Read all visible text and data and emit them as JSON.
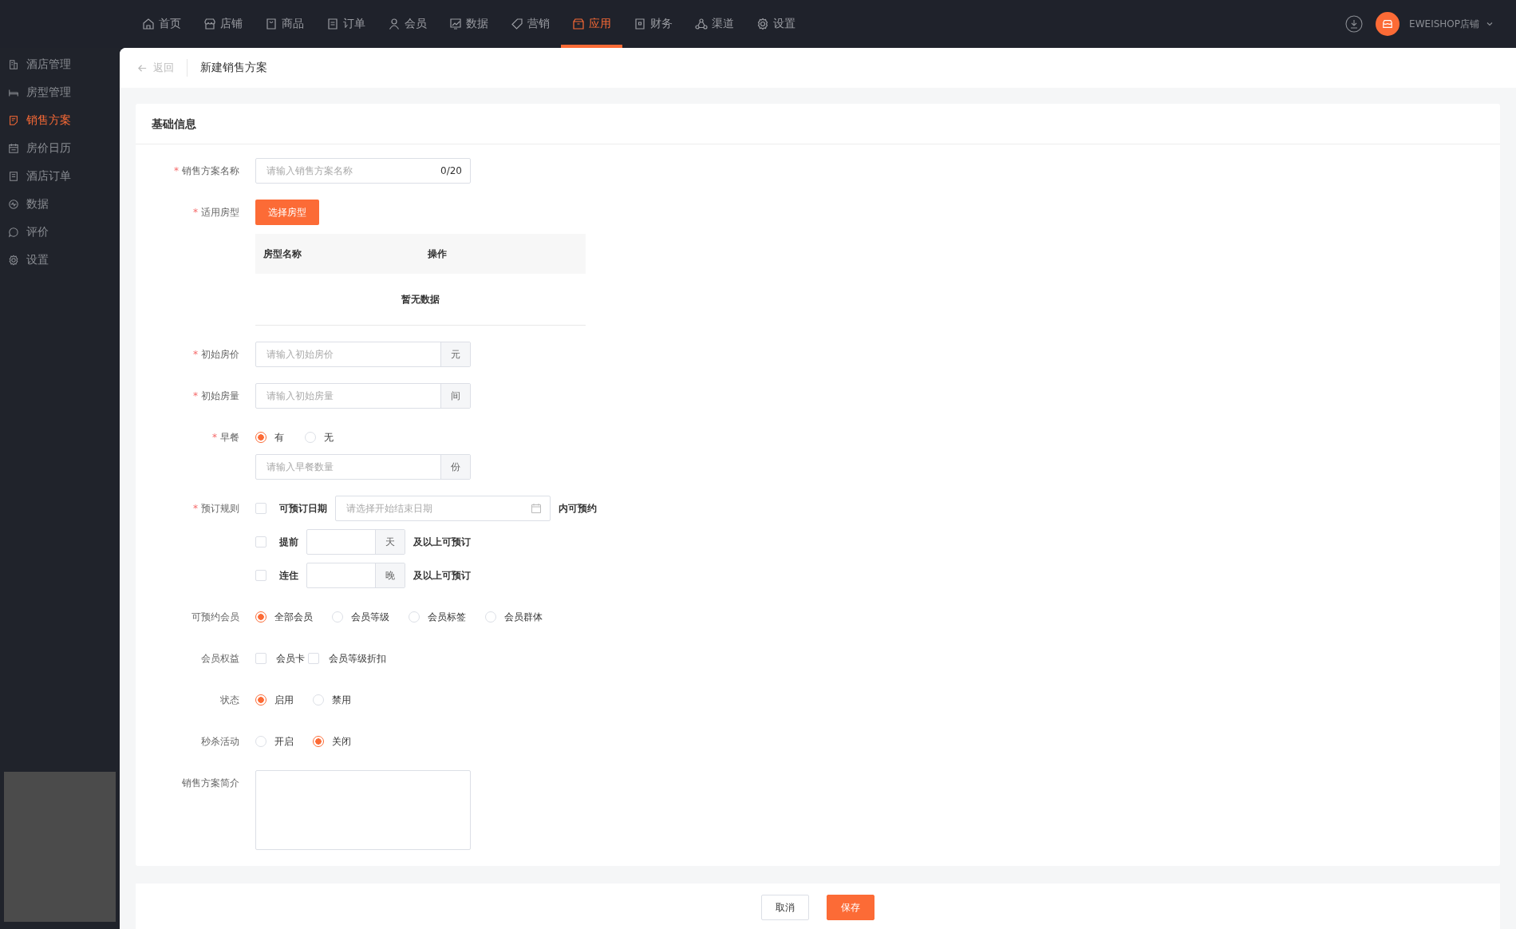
{
  "top_nav": [
    {
      "label": "首页",
      "selected": false
    },
    {
      "label": "店铺",
      "selected": false
    },
    {
      "label": "商品",
      "selected": false
    },
    {
      "label": "订单",
      "selected": false
    },
    {
      "label": "会员",
      "selected": false
    },
    {
      "label": "数据",
      "selected": false
    },
    {
      "label": "营销",
      "selected": false
    },
    {
      "label": "应用",
      "selected": true
    },
    {
      "label": "财务",
      "selected": false
    },
    {
      "label": "渠道",
      "selected": false
    },
    {
      "label": "设置",
      "selected": false
    }
  ],
  "account": {
    "name": "EWEISHOP店铺"
  },
  "sidebar": {
    "items": [
      {
        "label": "酒店管理",
        "selected": false
      },
      {
        "label": "房型管理",
        "selected": false
      },
      {
        "label": "销售方案",
        "selected": true
      },
      {
        "label": "房价日历",
        "selected": false
      },
      {
        "label": "酒店订单",
        "selected": false
      },
      {
        "label": "数据",
        "selected": false
      },
      {
        "label": "评价",
        "selected": false
      },
      {
        "label": "设置",
        "selected": false
      }
    ]
  },
  "page_header": {
    "back": "返回",
    "title": "新建销售方案"
  },
  "section_title": "基础信息",
  "fields": [
    {
      "kind": "text",
      "label": "销售方案名称",
      "required_mark": "*",
      "placeholder": "请输入销售方案名称",
      "counter": "0/20"
    },
    {
      "kind": "picker",
      "label": "适用房型",
      "required_mark": "*",
      "button": "选择房型",
      "table": {
        "columns": [
          "房型名称",
          "操作"
        ],
        "empty": "暂无数据"
      }
    },
    {
      "kind": "addon",
      "label": "初始房价",
      "required_mark": "*",
      "placeholder": "请输入初始房价",
      "suffix": "元"
    },
    {
      "kind": "addon",
      "label": "初始房量",
      "required_mark": "*",
      "placeholder": "请输入初始房量",
      "suffix": "间"
    },
    {
      "kind": "breakfast",
      "label": "早餐",
      "required_mark": "*",
      "options": [
        {
          "label": "有",
          "selected": true
        },
        {
          "label": "无",
          "selected": false
        }
      ],
      "placeholder": "请输入早餐数量",
      "suffix": "份"
    },
    {
      "kind": "rules",
      "label": "预订规则",
      "required_mark": "*",
      "rules": [
        {
          "kind": "date",
          "checked": false,
          "label": "可预订日期",
          "placeholder": "请选择开始结束日期",
          "after": "内可预约"
        },
        {
          "kind": "number",
          "checked": false,
          "label": "提前",
          "suffix": "天",
          "after": "及以上可预订"
        },
        {
          "kind": "number",
          "checked": false,
          "label": "连住",
          "suffix": "晚",
          "after": "及以上可预订"
        }
      ]
    },
    {
      "kind": "radio",
      "label": "可预约会员",
      "options": [
        {
          "label": "全部会员",
          "selected": true
        },
        {
          "label": "会员等级",
          "selected": false
        },
        {
          "label": "会员标签",
          "selected": false
        },
        {
          "label": "会员群体",
          "selected": false
        }
      ]
    },
    {
      "kind": "checks",
      "label": "会员权益",
      "options": [
        {
          "label": "会员卡",
          "checked": false
        },
        {
          "label": "会员等级折扣",
          "checked": false
        }
      ]
    },
    {
      "kind": "radio",
      "label": "状态",
      "options": [
        {
          "label": "启用",
          "selected": true
        },
        {
          "label": "禁用",
          "selected": false
        }
      ]
    },
    {
      "kind": "radio",
      "label": "秒杀活动",
      "options": [
        {
          "label": "开启",
          "selected": false
        },
        {
          "label": "关闭",
          "selected": true
        }
      ]
    },
    {
      "kind": "textarea",
      "label": "销售方案简介"
    }
  ],
  "footer_buttons": [
    {
      "label": "取消",
      "kind": "default"
    },
    {
      "label": "保存",
      "kind": "primary"
    }
  ]
}
